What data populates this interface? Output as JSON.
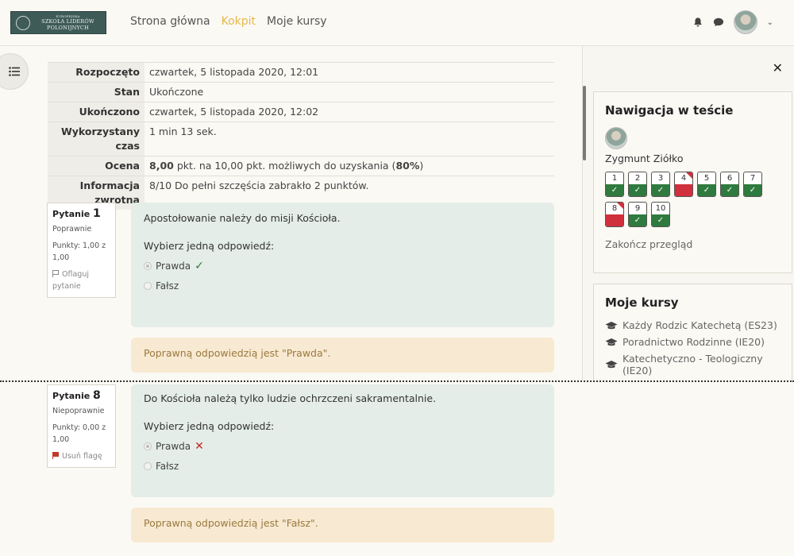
{
  "header": {
    "logo": {
      "line1": "EUROPEJSKA",
      "line2": "SZKOŁA LIDERÓW",
      "line3": "POLONIJNYCH"
    },
    "nav": [
      "Strona główna",
      "Kokpit",
      "Moje kursy"
    ],
    "active_nav": "Kokpit"
  },
  "summary": [
    {
      "label": "Rozpoczęto",
      "value": "czwartek, 5 listopada 2020, 12:01"
    },
    {
      "label": "Stan",
      "value": "Ukończone"
    },
    {
      "label": "Ukończono",
      "value": "czwartek, 5 listopada 2020, 12:02"
    },
    {
      "label": "Wykorzystany czas",
      "value": "1 min 13 sek."
    },
    {
      "label": "Ocena",
      "value_bold1": "8,00",
      "value_mid": " pkt. na 10,00 pkt. możliwych do uzyskania (",
      "value_bold2": "80%",
      "value_end": ")"
    },
    {
      "label": "Informacja zwrotna",
      "value": "8/10 Do pełni szczęścia zabrakło 2 punktów."
    }
  ],
  "questions": [
    {
      "label": "Pytanie",
      "number": "1",
      "state": "Poprawnie",
      "points": "Punkty: 1,00 z 1,00",
      "flag": "Oflaguj pytanie",
      "text": "Apostołowanie należy do misji Kościoła.",
      "prompt": "Wybierz jedną odpowiedź:",
      "answers": [
        "Prawda",
        "Fałsz"
      ],
      "feedback": "Poprawną odpowiedzią jest \"Prawda\"."
    },
    {
      "label": "Pytanie",
      "number": "8",
      "state": "Niepoprawnie",
      "points": "Punkty: 0,00 z 1,00",
      "flag": "Usuń flagę",
      "text": "Do Kościoła należą tylko ludzie ochrzczeni sakramentalnie.",
      "prompt": "Wybierz jedną odpowiedź:",
      "answers": [
        "Prawda",
        "Fałsz"
      ],
      "feedback": "Poprawną odpowiedzią jest \"Fałsz\"."
    }
  ],
  "drawer": {
    "nav_title": "Nawigacja w teście",
    "user_name": "Zygmunt Ziółko",
    "qnav": [
      {
        "n": "1",
        "state": "correct"
      },
      {
        "n": "2",
        "state": "correct"
      },
      {
        "n": "3",
        "state": "correct"
      },
      {
        "n": "4",
        "state": "incorrect"
      },
      {
        "n": "5",
        "state": "correct"
      },
      {
        "n": "6",
        "state": "correct"
      },
      {
        "n": "7",
        "state": "correct"
      },
      {
        "n": "8",
        "state": "incorrect"
      },
      {
        "n": "9",
        "state": "correct"
      },
      {
        "n": "10",
        "state": "correct"
      }
    ],
    "finish": "Zakończ przegląd",
    "courses_title": "Moje kursy",
    "courses": [
      "Każdy Rodzic Katechetą (ES23)",
      "Poradnictwo Rodzinne (IE20)",
      "Katechetyczno - Teologiczny (IE20)"
    ]
  },
  "colors": {
    "accent": "#e6b84c",
    "correct": "#2f7a3e",
    "incorrect": "#d0303b",
    "formulation_bg": "#e4ede8",
    "feedback_bg": "#f8e9d2"
  }
}
